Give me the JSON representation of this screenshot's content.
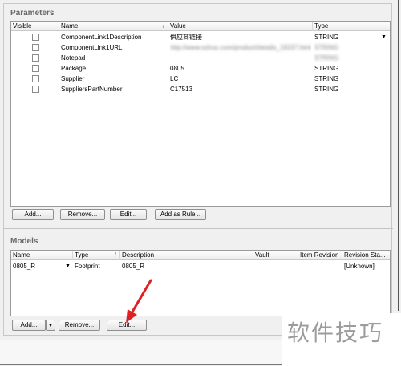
{
  "parameters": {
    "title": "Parameters",
    "columns": {
      "visible": "Visible",
      "name": "Name",
      "value": "Value",
      "type": "Type"
    },
    "rows": [
      {
        "name": "ComponentLink1Description",
        "value": "供应商链接",
        "type": "STRING",
        "blur_value": false,
        "blur_type": false
      },
      {
        "name": "ComponentLink1URL",
        "value": "http://www.szlcsc.com/product/details_19237.html",
        "type": "STRING",
        "blur_value": true,
        "blur_type": true
      },
      {
        "name": "Notepad",
        "value": "",
        "type": "STRING",
        "blur_value": false,
        "blur_type": true
      },
      {
        "name": "Package",
        "value": "0805",
        "type": "STRING",
        "blur_value": false,
        "blur_type": false
      },
      {
        "name": "Supplier",
        "value": "LC",
        "type": "STRING",
        "blur_value": false,
        "blur_type": false
      },
      {
        "name": "SuppliersPartNumber",
        "value": "C17513",
        "type": "STRING",
        "blur_value": false,
        "blur_type": false
      }
    ],
    "buttons": {
      "add": "Add...",
      "remove": "Remove...",
      "edit": "Edit...",
      "add_as_rule": "Add as Rule..."
    }
  },
  "models": {
    "title": "Models",
    "columns": {
      "name": "Name",
      "type": "Type",
      "description": "Description",
      "vault": "Vault",
      "item_revision": "Item Revision",
      "revision_state": "Revision Sta..."
    },
    "rows": [
      {
        "name": "0805_R",
        "type": "Footprint",
        "description": "0805_R",
        "vault": "",
        "item_revision": "",
        "revision_state": "[Unknown]"
      }
    ],
    "buttons": {
      "add": "Add...",
      "remove": "Remove...",
      "edit": "Edit..."
    }
  },
  "watermark": "软件技巧",
  "colors": {
    "annotation_arrow": "#e02020"
  }
}
